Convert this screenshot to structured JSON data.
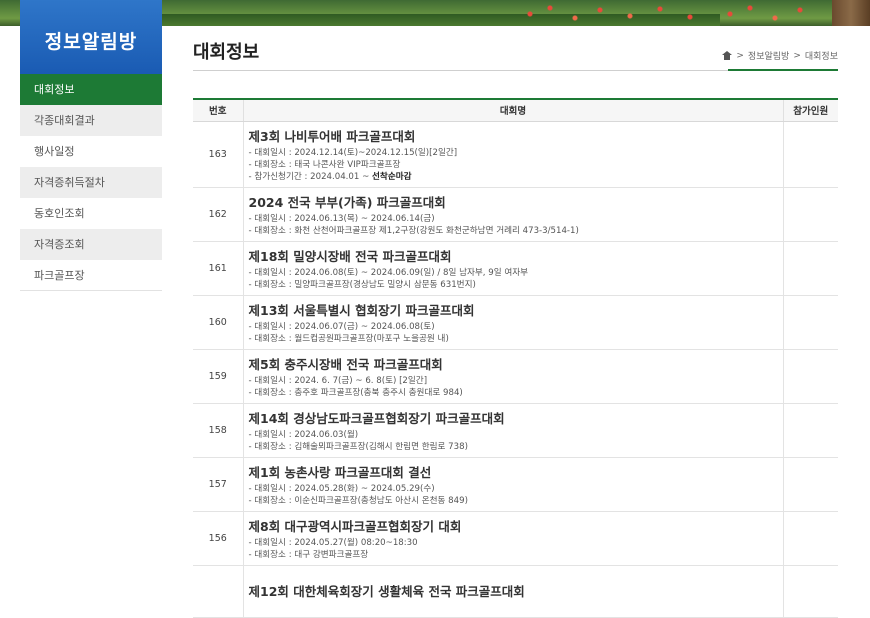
{
  "sidebar": {
    "title": "정보알림방",
    "items": [
      {
        "label": "대회정보"
      },
      {
        "label": "각종대회결과"
      },
      {
        "label": "행사일정"
      },
      {
        "label": "자격증취득절차"
      },
      {
        "label": "동호인조회"
      },
      {
        "label": "자격증조회"
      },
      {
        "label": "파크골프장"
      }
    ]
  },
  "page": {
    "title": "대회정보",
    "breadcrumb": [
      "정보알림방",
      "대회정보"
    ],
    "breadcrumb_sep": ">"
  },
  "table": {
    "headers": {
      "no": "번호",
      "name": "대회명",
      "count": "참가인원"
    },
    "rows": [
      {
        "no": "163",
        "title": "제3회 나비투어배 파크골프대회",
        "lines": [
          "- 대회일시 : 2024.12.14(토)~2024.12.15(일)[2일간]",
          "- 대회장소 : 태국 나콘사완 VIP파크골프장"
        ],
        "extra_prefix": "- 참가신청기간 : 2024.04.01 ~ ",
        "extra_bold": "선착순마감"
      },
      {
        "no": "162",
        "title": "2024 전국 부부(가족) 파크골프대회",
        "lines": [
          "- 대회일시 : 2024.06.13(목) ~ 2024.06.14(금)",
          "- 대회장소 : 화천 산천어파크골프장 제1,2구장(강원도 화천군하남면 거례리 473-3/514-1)"
        ]
      },
      {
        "no": "161",
        "title": "제18회 밀양시장배 전국 파크골프대회",
        "lines": [
          "- 대회일시 : 2024.06.08(토) ~ 2024.06.09(일) / 8일 남자부, 9일 여자부",
          "- 대회장소 : 밀양파크골프장(경상남도 밀양시 삼문동 631번지)"
        ]
      },
      {
        "no": "160",
        "title": "제13회 서울특별시 협회장기 파크골프대회",
        "lines": [
          "- 대회일시 : 2024.06.07(금) ~ 2024.06.08(토)",
          "- 대회장소 : 월드컵공원파크골프장(마포구 노을공원 내)"
        ]
      },
      {
        "no": "159",
        "title": "제5회 충주시장배 전국 파크골프대회",
        "lines": [
          "- 대회일시 : 2024. 6. 7(금) ~ 6. 8(토) [2일간]",
          "- 대회장소 : 충주호 파크골프장(충북 충주시 충원대로 984)"
        ]
      },
      {
        "no": "158",
        "title": "제14회 경상남도파크골프협회장기 파크골프대회",
        "lines": [
          "- 대회일시 : 2024.06.03(월)",
          "- 대회장소 : 김해술뫼파크골프장(김해시 한림면 한림로 738)"
        ]
      },
      {
        "no": "157",
        "title": "제1회 농촌사랑 파크골프대회 결선",
        "lines": [
          "- 대회일시 : 2024.05.28(화) ~ 2024.05.29(수)",
          "- 대회장소 : 이순신파크골프장(충청남도 아산시 온천동 849)"
        ]
      },
      {
        "no": "156",
        "title": "제8회 대구광역시파크골프협회장기 대회",
        "lines": [
          "- 대회일시 : 2024.05.27(월) 08:20~18:30",
          "- 대회장소 : 대구 강변파크골프장"
        ]
      },
      {
        "no": "",
        "title": "제12회 대한체육회장기 생활체육 전국 파크골프대회",
        "lines": []
      }
    ]
  }
}
